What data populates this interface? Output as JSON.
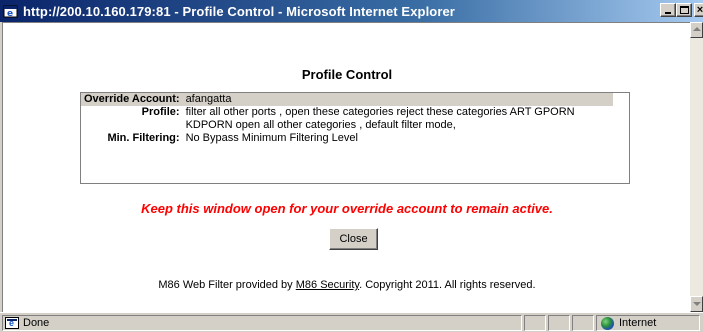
{
  "window": {
    "title": "http://200.10.160.179:81 - Profile Control - Microsoft Internet Explorer"
  },
  "page": {
    "heading": "Profile Control",
    "profile": {
      "override_account_label": "Override Account:",
      "override_account_value": "afangatta",
      "profile_label": "Profile:",
      "profile_value": "filter all other ports , open these categories reject these categories ART GPORN KDPORN open all other categories , default filter mode,",
      "min_filtering_label": "Min. Filtering:",
      "min_filtering_value": "No Bypass Minimum Filtering Level"
    },
    "warning": "Keep this window open for your override account to remain active.",
    "close_label": "Close",
    "footer": {
      "prefix": "M86 Web Filter provided by ",
      "link": "M86 Security",
      "suffix": ". Copyright 2011. All rights reserved."
    }
  },
  "statusbar": {
    "status": "Done",
    "zone": "Internet"
  },
  "colors": {
    "titlebar": "#0a246a",
    "warning": "#ff0000",
    "chrome": "#d4d0c8"
  },
  "icons": {
    "title": "ie-icon",
    "status": "page-done-icon",
    "zone": "globe-icon"
  }
}
